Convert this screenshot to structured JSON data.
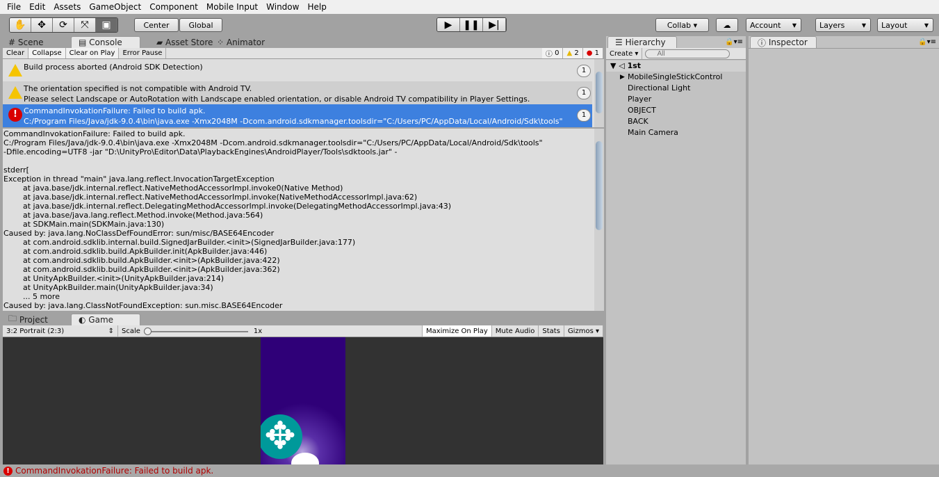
{
  "menu": [
    "File",
    "Edit",
    "Assets",
    "GameObject",
    "Component",
    "Mobile Input",
    "Window",
    "Help"
  ],
  "toolbar": {
    "center": "Center",
    "global": "Global",
    "collab": "Collab ▾",
    "account": "Account",
    "layers": "Layers",
    "layout": "Layout"
  },
  "tabs": {
    "scene": "Scene",
    "console": "Console",
    "asset_store": "Asset Store",
    "animator": "Animator",
    "hierarchy": "Hierarchy",
    "inspector": "Inspector",
    "project": "Project",
    "game": "Game"
  },
  "console_toolbar": {
    "clear": "Clear",
    "collapse": "Collapse",
    "clear_on_play": "Clear on Play",
    "error_pause": "Error Pause",
    "info_count": "0",
    "warn_count": "2",
    "error_count": "1"
  },
  "console_entries": [
    {
      "type": "warning",
      "line1": "Build process aborted (Android SDK Detection)",
      "line2": "",
      "count": "1"
    },
    {
      "type": "warning",
      "line1": "The orientation specified is not compatible with Android TV.",
      "line2": "Please select Landscape or AutoRotation with Landscape enabled orientation, or disable Android TV compatibility in Player Settings.",
      "count": "1"
    },
    {
      "type": "error",
      "line1": "CommandInvokationFailure: Failed to build apk.",
      "line2": "C:/Program Files/Java/jdk-9.0.4\\bin\\java.exe -Xmx2048M -Dcom.android.sdkmanager.toolsdir=\"C:/Users/PC/AppData/Local/Android/Sdk\\tools\"",
      "count": "1",
      "selected": true
    }
  ],
  "detail_text": "CommandInvokationFailure: Failed to build apk.\nC:/Program Files/Java/jdk-9.0.4\\bin\\java.exe -Xmx2048M -Dcom.android.sdkmanager.toolsdir=\"C:/Users/PC/AppData/Local/Android/Sdk\\tools\"\n-Dfile.encoding=UTF8 -jar \"D:\\UnityPro\\Editor\\Data\\PlaybackEngines\\AndroidPlayer/Tools\\sdktools.jar\" -\n\nstderr[\nException in thread \"main\" java.lang.reflect.InvocationTargetException\n\tat java.base/jdk.internal.reflect.NativeMethodAccessorImpl.invoke0(Native Method)\n\tat java.base/jdk.internal.reflect.NativeMethodAccessorImpl.invoke(NativeMethodAccessorImpl.java:62)\n\tat java.base/jdk.internal.reflect.DelegatingMethodAccessorImpl.invoke(DelegatingMethodAccessorImpl.java:43)\n\tat java.base/java.lang.reflect.Method.invoke(Method.java:564)\n\tat SDKMain.main(SDKMain.java:130)\nCaused by: java.lang.NoClassDefFoundError: sun/misc/BASE64Encoder\n\tat com.android.sdklib.internal.build.SignedJarBuilder.<init>(SignedJarBuilder.java:177)\n\tat com.android.sdklib.build.ApkBuilder.init(ApkBuilder.java:446)\n\tat com.android.sdklib.build.ApkBuilder.<init>(ApkBuilder.java:422)\n\tat com.android.sdklib.build.ApkBuilder.<init>(ApkBuilder.java:362)\n\tat UnityApkBuilder.<init>(UnityApkBuilder.java:214)\n\tat UnityApkBuilder.main(UnityApkBuilder.java:34)\n\t... 5 more\nCaused by: java.lang.ClassNotFoundException: sun.misc.BASE64Encoder",
  "hierarchy": {
    "create": "Create ▾",
    "search_placeholder": "All",
    "scene": "1st",
    "items": [
      "MobileSingleStickControl",
      "Directional Light",
      "Player",
      "OBJECT",
      "BACK",
      "Main Camera"
    ]
  },
  "game_toolbar": {
    "aspect": "3:2 Portrait (2:3)",
    "scale_label": "Scale",
    "scale_value": "1x",
    "maximize": "Maximize On Play",
    "mute": "Mute Audio",
    "stats": "Stats",
    "gizmos": "Gizmos"
  },
  "status": "CommandInvokationFailure: Failed to build apk.",
  "colors": {
    "selected_row": "#3d80df",
    "error": "#d90000",
    "game_bg": "#2f0078",
    "joystick": "#00999a"
  }
}
